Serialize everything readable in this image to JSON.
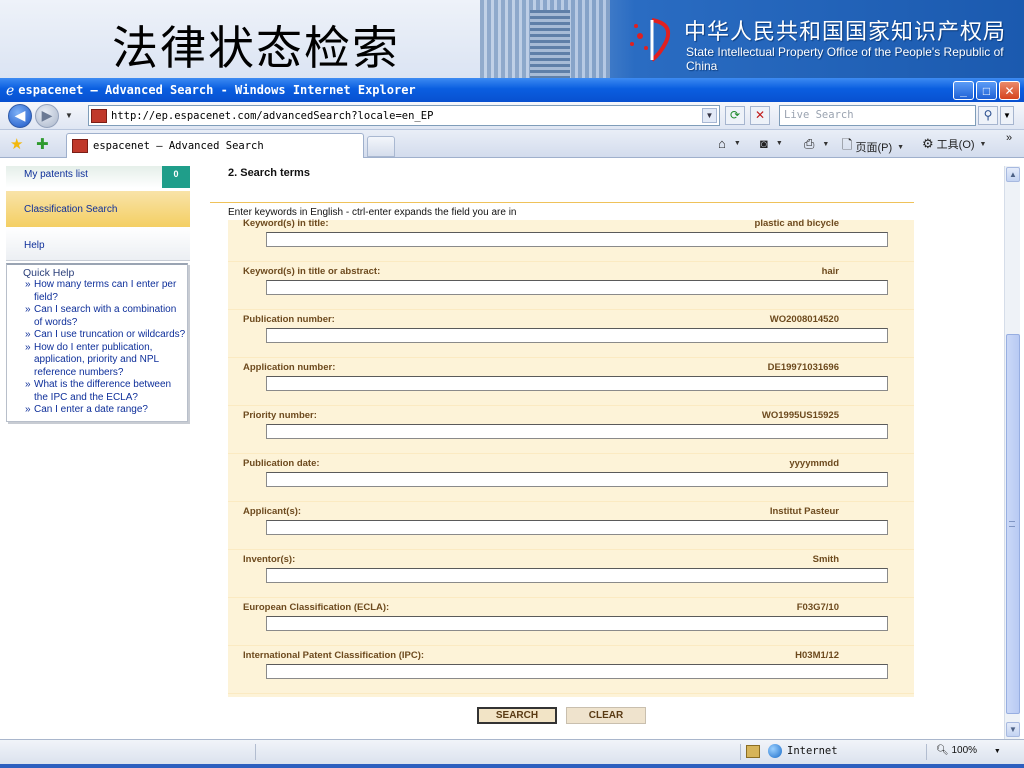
{
  "slide": {
    "title": "法律状态检索",
    "org_cn": "中华人民共和国国家知识产权局",
    "org_en": "State Intellectual Property Office of the People's Republic of China"
  },
  "browser": {
    "window_title": "espacenet — Advanced Search - Windows Internet Explorer",
    "url": "http://ep.espacenet.com/advancedSearch?locale=en_EP",
    "search_placeholder": "Live Search",
    "tab_label": "espacenet — Advanced Search",
    "cmd_page": "页面(P)",
    "cmd_tools": "工具(O)",
    "status_zone": "Internet",
    "zoom": "100%"
  },
  "sidebar": {
    "my_patents": "My patents list",
    "my_patents_count": "0",
    "classification": "Classification Search",
    "help": "Help",
    "quick_help_title": "Quick Help",
    "quick_help": [
      "How many terms can I enter per field?",
      "Can I search with a combination of words?",
      "Can I use truncation or wildcards?",
      "How do I enter publication, application, priority and NPL reference numbers?",
      "What is the difference between the IPC and the ECLA?",
      "Can I enter a date range?"
    ]
  },
  "form": {
    "section_title": "2. Search terms",
    "hint": "Enter keywords in English - ctrl-enter expands the field you are in",
    "fields": [
      {
        "label": "Keyword(s) in title:",
        "example": "plastic and bicycle"
      },
      {
        "label": "Keyword(s) in title or abstract:",
        "example": "hair"
      },
      {
        "label": "Publication number:",
        "example": "WO2008014520"
      },
      {
        "label": "Application number:",
        "example": "DE19971031696"
      },
      {
        "label": "Priority number:",
        "example": "WO1995US15925"
      },
      {
        "label": "Publication date:",
        "example": "yyyymmdd"
      },
      {
        "label": "Applicant(s):",
        "example": "Institut Pasteur"
      },
      {
        "label": "Inventor(s):",
        "example": "Smith"
      },
      {
        "label": "European Classification (ECLA):",
        "example": "F03G7/10"
      },
      {
        "label": "International Patent Classification (IPC):",
        "example": "H03M1/12"
      }
    ],
    "search_label": "SEARCH",
    "clear_label": "CLEAR"
  },
  "colors": {
    "form_bg": "#fdf3d8",
    "label_brown": "#6d4a1e",
    "link_blue": "#0e2f9a",
    "ie_blue": "#0a5ee0"
  }
}
